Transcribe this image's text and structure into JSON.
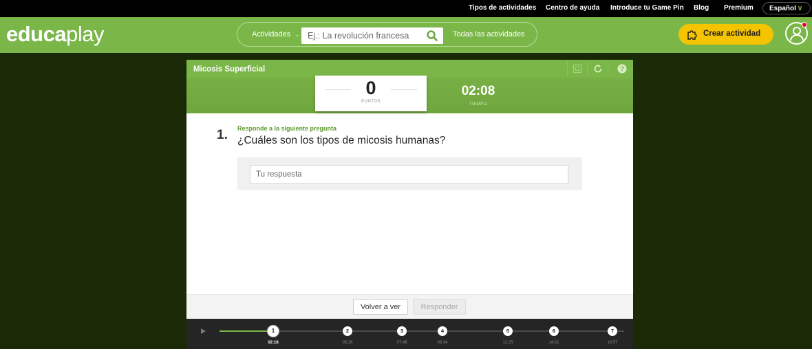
{
  "topbar": {
    "links": [
      "Tipos de actividades",
      "Centro de ayuda",
      "Introduce tu Game Pin",
      "Blog",
      "Premium"
    ],
    "language": "Español"
  },
  "header": {
    "logo_bold": "educa",
    "logo_light": "play",
    "activities_dropdown": "Actividades",
    "search_placeholder": "Ej.: La revolución francesa",
    "all_activities": "Todas las actividades",
    "create_button": "Crear actividad"
  },
  "activity": {
    "title": "Micosis Superficial",
    "score": "0",
    "score_label": "PUNTOS",
    "time": "02:08",
    "time_label": "TIEMPO",
    "question_number": "1.",
    "question_hint": "Responde a la siguiente pregunta",
    "question_text": "¿Cuáles son los tipos de micosis humanas?",
    "answer_placeholder": "Tu respuesta",
    "back_button": "Volver a ver",
    "answer_button": "Responder"
  },
  "timeline": {
    "steps": [
      {
        "n": "1",
        "time": "02:18",
        "current": true
      },
      {
        "n": "2",
        "time": "05:26",
        "current": false
      },
      {
        "n": "3",
        "time": "07:49",
        "current": false
      },
      {
        "n": "4",
        "time": "09:34",
        "current": false
      },
      {
        "n": "5",
        "time": "12:25",
        "current": false
      },
      {
        "n": "6",
        "time": "14:21",
        "current": false
      },
      {
        "n": "7",
        "time": "16:57",
        "current": false
      }
    ]
  },
  "colors": {
    "brand_green": "#7ab648",
    "create_yellow": "#f5c400",
    "background": "#1a2a06",
    "timeline_bg": "#252525"
  },
  "icons": [
    "search-icon",
    "puzzle-icon",
    "user-icon",
    "fullscreen-icon",
    "restart-icon",
    "help-icon",
    "play-icon"
  ]
}
